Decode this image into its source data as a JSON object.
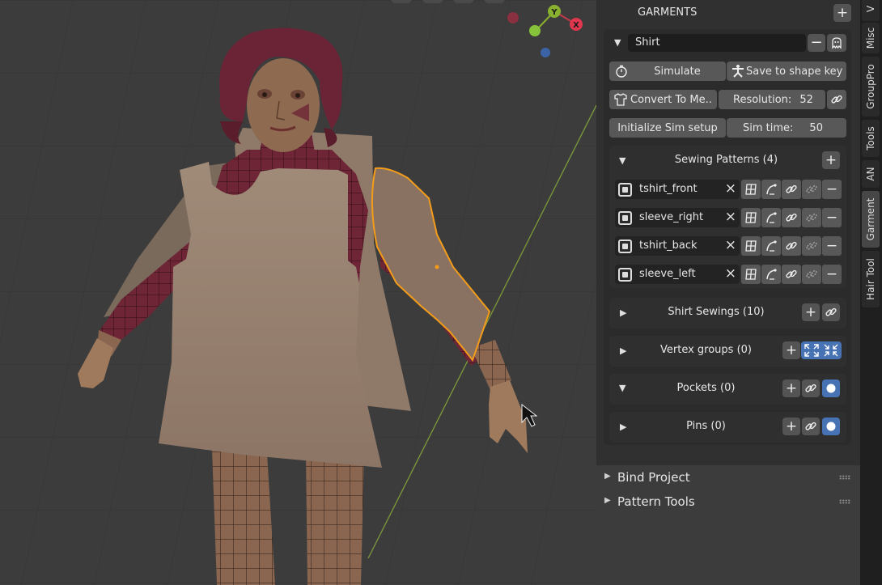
{
  "panel": {
    "title": "GARMENTS",
    "garment_name": "Shirt",
    "buttons": {
      "simulate": "Simulate",
      "save_shape_key": "Save to shape key",
      "convert": "Convert To Me..",
      "resolution_label": "Resolution:",
      "resolution_value": "52",
      "init_sim": "Initialize Sim setup",
      "sim_time_label": "Sim time:",
      "sim_time_value": "50"
    },
    "sewing_patterns": {
      "title": "Sewing Patterns (4)",
      "items": [
        {
          "name": "tshirt_front"
        },
        {
          "name": "sleeve_right"
        },
        {
          "name": "tshirt_back"
        },
        {
          "name": "sleeve_left"
        }
      ]
    },
    "sections": {
      "shirt_sewings": "Shirt Sewings (10)",
      "vertex_groups": "Vertex groups (0)",
      "pockets": "Pockets (0)",
      "pins": "Pins (0)"
    },
    "lower": {
      "bind_project": "Bind Project",
      "pattern_tools": "Pattern Tools"
    }
  },
  "tabs": [
    "V",
    "Misc",
    "GroupPro",
    "Tools",
    "AN",
    "Garment",
    "Hair Tool"
  ],
  "gizmo": {
    "y_label": "Y",
    "x_label": "X"
  },
  "colors": {
    "accent_blue": "#4772b3",
    "selection_orange": "#f39c1a"
  },
  "icons": [
    "stopwatch-icon",
    "pose-icon",
    "shirt-icon",
    "link-icon",
    "grid-icon",
    "curve-icon",
    "unlink-icon",
    "ghost-icon",
    "fullscreen-icon"
  ]
}
